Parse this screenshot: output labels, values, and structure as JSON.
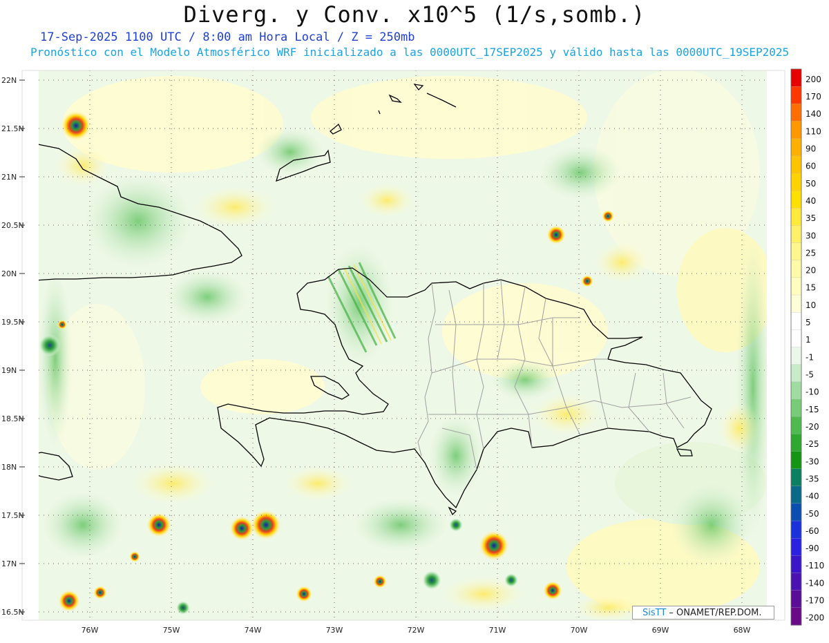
{
  "header": {
    "title": "Diverg. y Conv. x10^5 (1/s,somb.)",
    "subtitle_line1": "17-Sep-2025  1100 UTC / 8:00 am Hora Local / Z = 250mb",
    "subtitle_line2": "Pronóstico con el Modelo Atmosférico WRF inicializado a las 0000UTC_17SEP2025 y válido hasta las  0000UTC_19SEP2025"
  },
  "map": {
    "lat_labels": [
      "22N",
      "21.5N",
      "21N",
      "20.5N",
      "20N",
      "19.5N",
      "19N",
      "18.5N",
      "18N",
      "17.5N",
      "17N",
      "16.5N"
    ],
    "lon_labels": [
      "76W",
      "75W",
      "74W",
      "73W",
      "72W",
      "71W",
      "70W",
      "69W",
      "68W"
    ],
    "field_colors": {
      "background": "#ffffff",
      "weak_div": "#fdfbc8",
      "weak_conv": "#e6f6e6",
      "mod_conv": "#9fdc9f",
      "strong_conv": "#2ea84a",
      "strong_div": "#ffd21f"
    }
  },
  "colorbar": {
    "labels": [
      "200",
      "170",
      "140",
      "110",
      "90",
      "60",
      "50",
      "40",
      "35",
      "30",
      "25",
      "20",
      "15",
      "10",
      "5",
      "1",
      "-1",
      "-5",
      "-10",
      "-15",
      "-20",
      "-25",
      "-30",
      "-35",
      "-40",
      "-50",
      "-60",
      "-90",
      "-110",
      "-140",
      "-170",
      "-200"
    ],
    "colors": [
      "#e80000",
      "#ff3800",
      "#ff6e00",
      "#ff9800",
      "#ffb000",
      "#ffc400",
      "#ffd200",
      "#ffe000",
      "#ffe93a",
      "#fff06a",
      "#fff68e",
      "#fffaa8",
      "#fffcc0",
      "#fdfdd8",
      "#ffffff",
      "#ffffff",
      "#eaf7ea",
      "#c8ecc8",
      "#a0dca0",
      "#78cc78",
      "#4fba4f",
      "#2ea82e",
      "#149614",
      "#0a8060",
      "#0a6a8a",
      "#0a4fb0",
      "#1a32d8",
      "#2a22e0",
      "#3a16c8",
      "#4a12b0",
      "#5a0e98",
      "#6a0a88"
    ]
  },
  "credit": {
    "brand": "SisTT",
    "text": " – ONAMET/REP.DOM."
  }
}
